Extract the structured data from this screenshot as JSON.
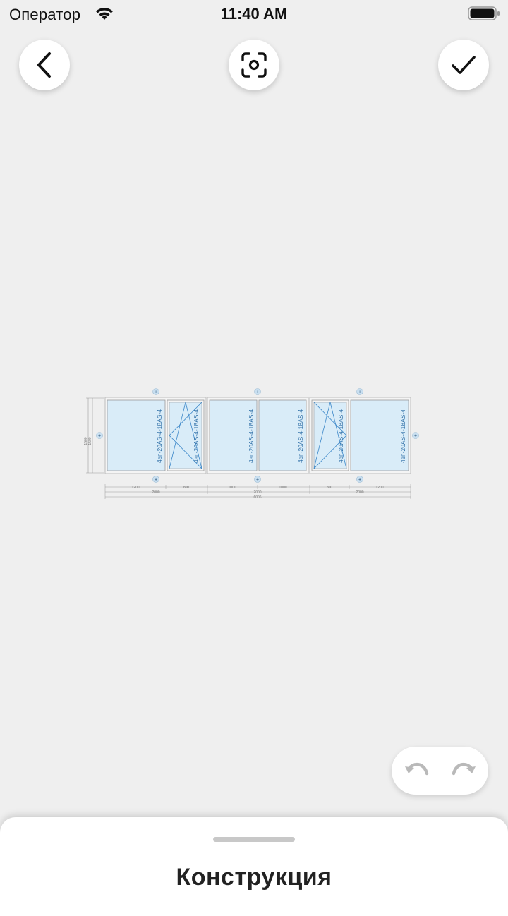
{
  "status_bar": {
    "carrier": "Оператор",
    "time": "11:40 AM",
    "wifi_icon": "wifi-icon",
    "battery_icon": "battery-icon"
  },
  "toolbar": {
    "back_icon": "chevron-left-icon",
    "focus_icon": "focus-frame-icon",
    "done_icon": "checkmark-icon"
  },
  "drawing": {
    "glass_formula": "4эп-20AS-4-18AS-4",
    "height_outer": "1500",
    "height_inner": "1500",
    "segment_widths": [
      "1200",
      "800",
      "1000",
      "1000",
      "800",
      "1200"
    ],
    "frame_widths": [
      "2000",
      "2000",
      "2000"
    ],
    "total_width": "6006",
    "colors": {
      "glass": "#d9ecf8",
      "frame": "#cfcfcf",
      "text": "#2f6fa7",
      "sash_line": "#3a86c8"
    }
  },
  "history": {
    "undo_icon": "undo-icon",
    "redo_icon": "redo-icon"
  },
  "sheet": {
    "title": "Конструкция"
  }
}
